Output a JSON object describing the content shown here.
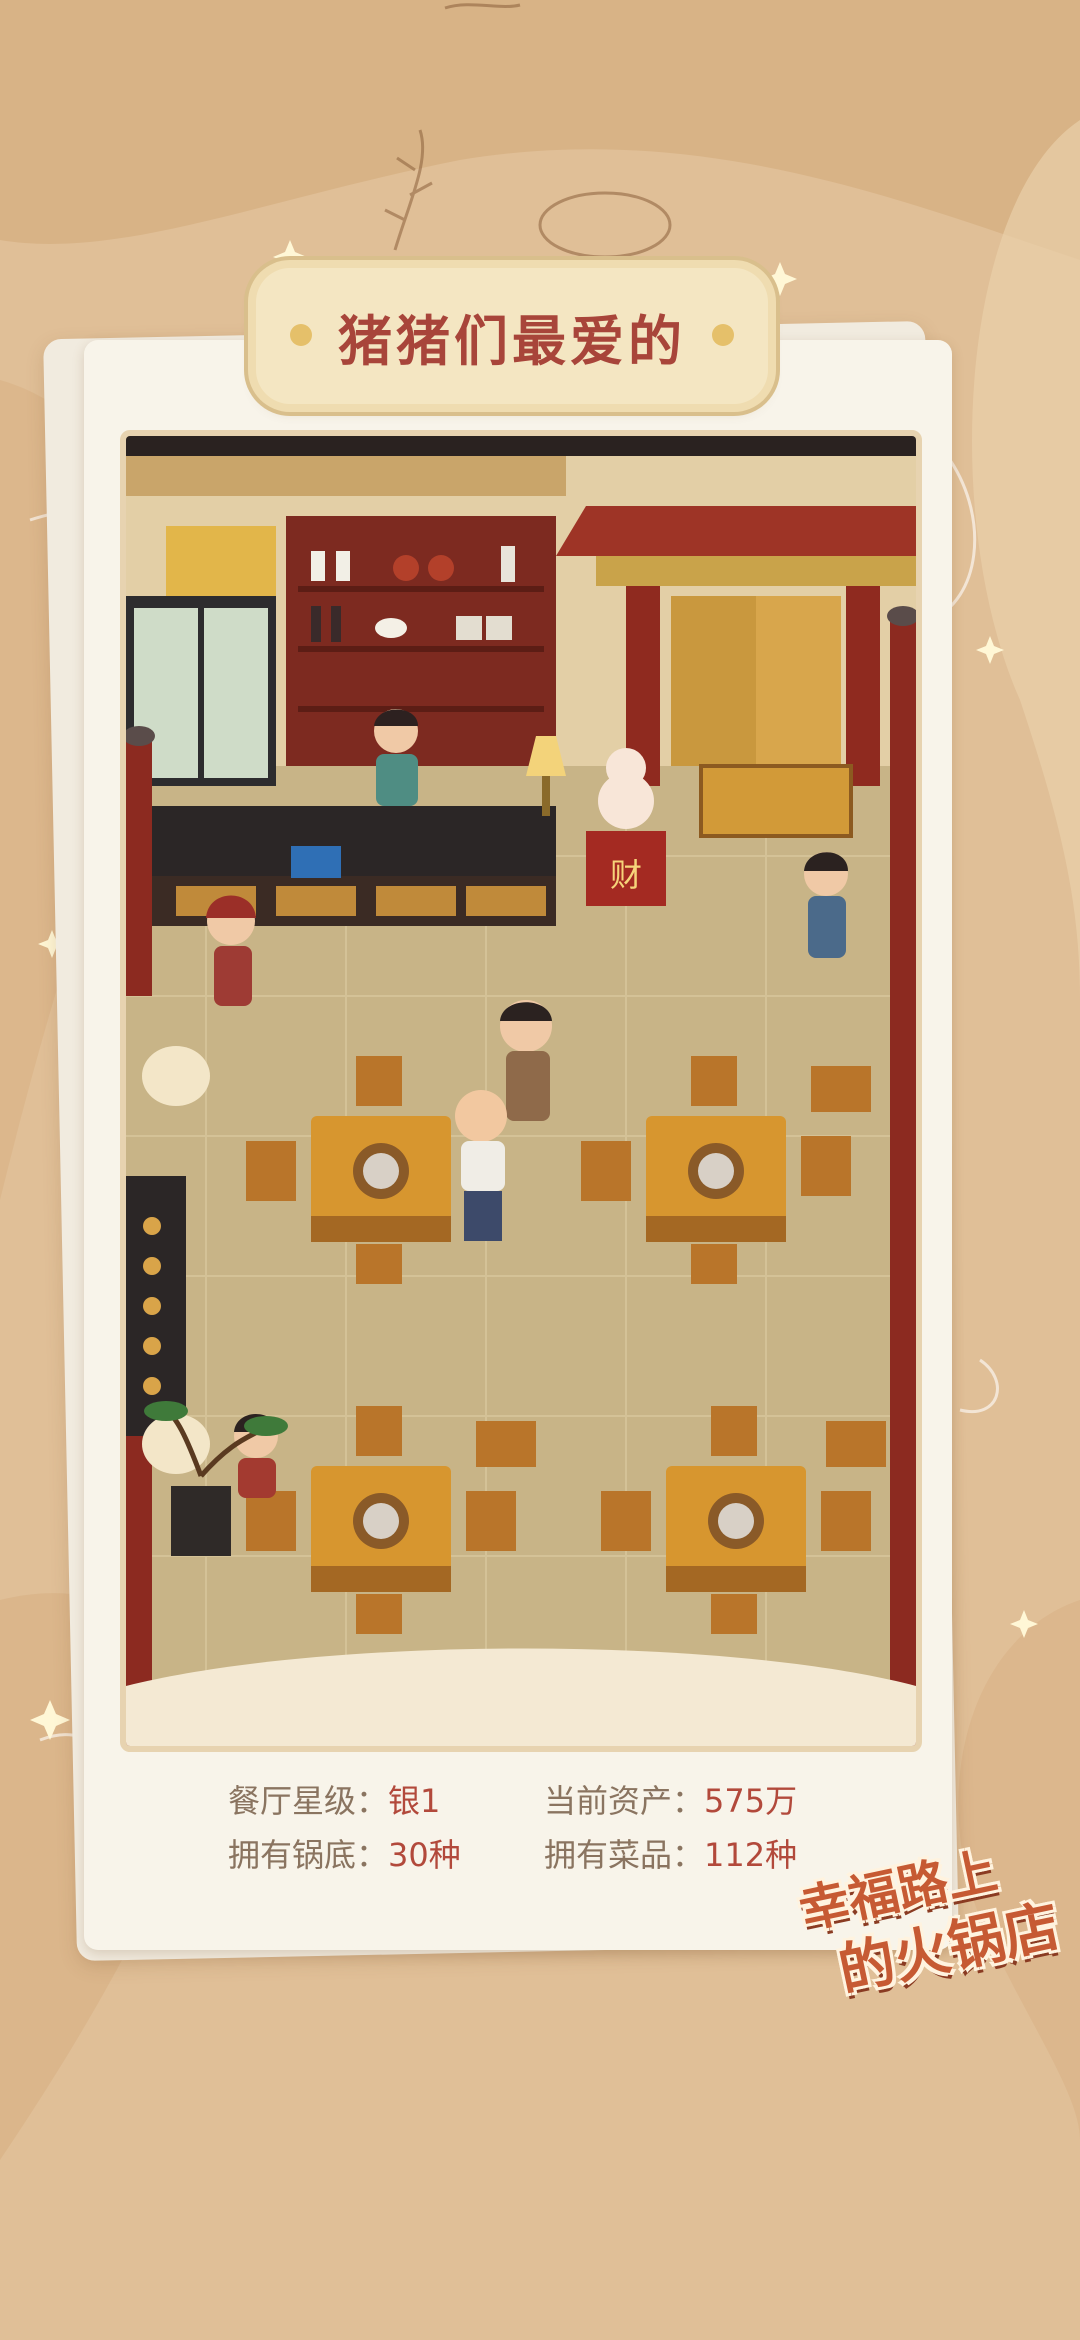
{
  "banner": {
    "title": "猪猪们最爱的"
  },
  "stats": {
    "star_label": "餐厅星级：",
    "star_value": "银1",
    "asset_label": "当前资产：",
    "asset_value": "575万",
    "base_label": "拥有锅底：",
    "base_value": "30种",
    "dish_label": "拥有菜品：",
    "dish_value": "112种"
  },
  "logo": {
    "line1": "幸福路上",
    "line2": "的火锅店"
  },
  "scene": {
    "fortune_sign": "财"
  },
  "colors": {
    "background": "#e0bf97",
    "accent_red": "#b2493b",
    "wood": "#8b2e22",
    "table": "#d7962f"
  }
}
